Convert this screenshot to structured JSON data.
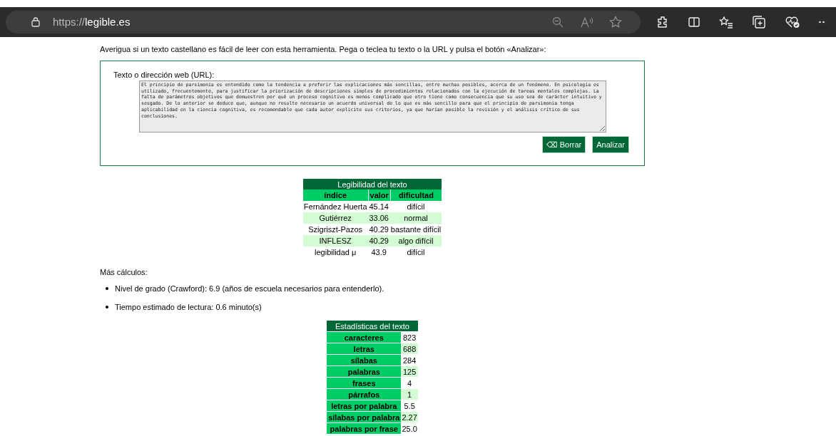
{
  "browser": {
    "url_prefix": "https://",
    "url_domain": "legible.es"
  },
  "intro": "Averigua si un texto castellano es fácil de leer con esta herramienta. Pega o teclea tu texto o la URL y pulsa el botón «Analizar»:",
  "form": {
    "label": "Texto o dirección web (URL):",
    "value": "El principio de parsimonia es entendido como la tendencia a preferir las explicaciones más sencillas, entre muchas posibles, acerca de un fenómeno. En psicología es utilizado, frecuentemente, para justificar la priorización de descripciones simples de procedimientos relacionados con la ejecución de tareas mentales complejas. La falta de parámetros objetivos que demuestren por qué un proceso cognitivo es menos complicado que otro tiene como consecuencia que su uso sea de carácter intuitivo y sesgado. De lo anterior se deduce que, aunque no resulte necesario un acuerdo universal de lo que es más sencillo para que el principio de parsimonia tenga aplicabilidad en la ciencia cognitiva, es recomendable que cada autor explicite sus criterios, ya que harían posible la revisión y el análisis crítico de sus conclusiones.",
    "buttons": [
      {
        "label": "⌫ Borrar"
      },
      {
        "label": "Analizar"
      }
    ]
  },
  "readability": {
    "title": "Legibilidad del texto",
    "columns": [
      "índice",
      "valor",
      "dificultad"
    ],
    "rows": [
      [
        "Fernández Huerta",
        "45.14",
        "difícil"
      ],
      [
        "Gutiérrez",
        "33.06",
        "normal"
      ],
      [
        "Szigriszt-Pazos",
        "40.29",
        "bastante difícil"
      ],
      [
        "INFLESZ",
        "40.29",
        "algo difícil"
      ],
      [
        "legibilidad μ",
        "43.9",
        "difícil"
      ]
    ]
  },
  "more": {
    "heading": "Más cálculos:",
    "items": [
      "Nivel de grado (Crawford): 6.9 (años de escuela necesarios para entenderlo).",
      "Tiempo estimado de lectura: 0.6 minuto(s)"
    ]
  },
  "stats": {
    "title": "Estadísticas del texto",
    "rows": [
      [
        "caracteres",
        "823"
      ],
      [
        "letras",
        "688"
      ],
      [
        "sílabas",
        "284"
      ],
      [
        "palabras",
        "125"
      ],
      [
        "frases",
        "4"
      ],
      [
        "párrafos",
        "1"
      ],
      [
        "letras por palabra",
        "5.5"
      ],
      [
        "sílabas por palabra",
        "2.27"
      ],
      [
        "palabras por frase",
        "25.0"
      ]
    ]
  }
}
